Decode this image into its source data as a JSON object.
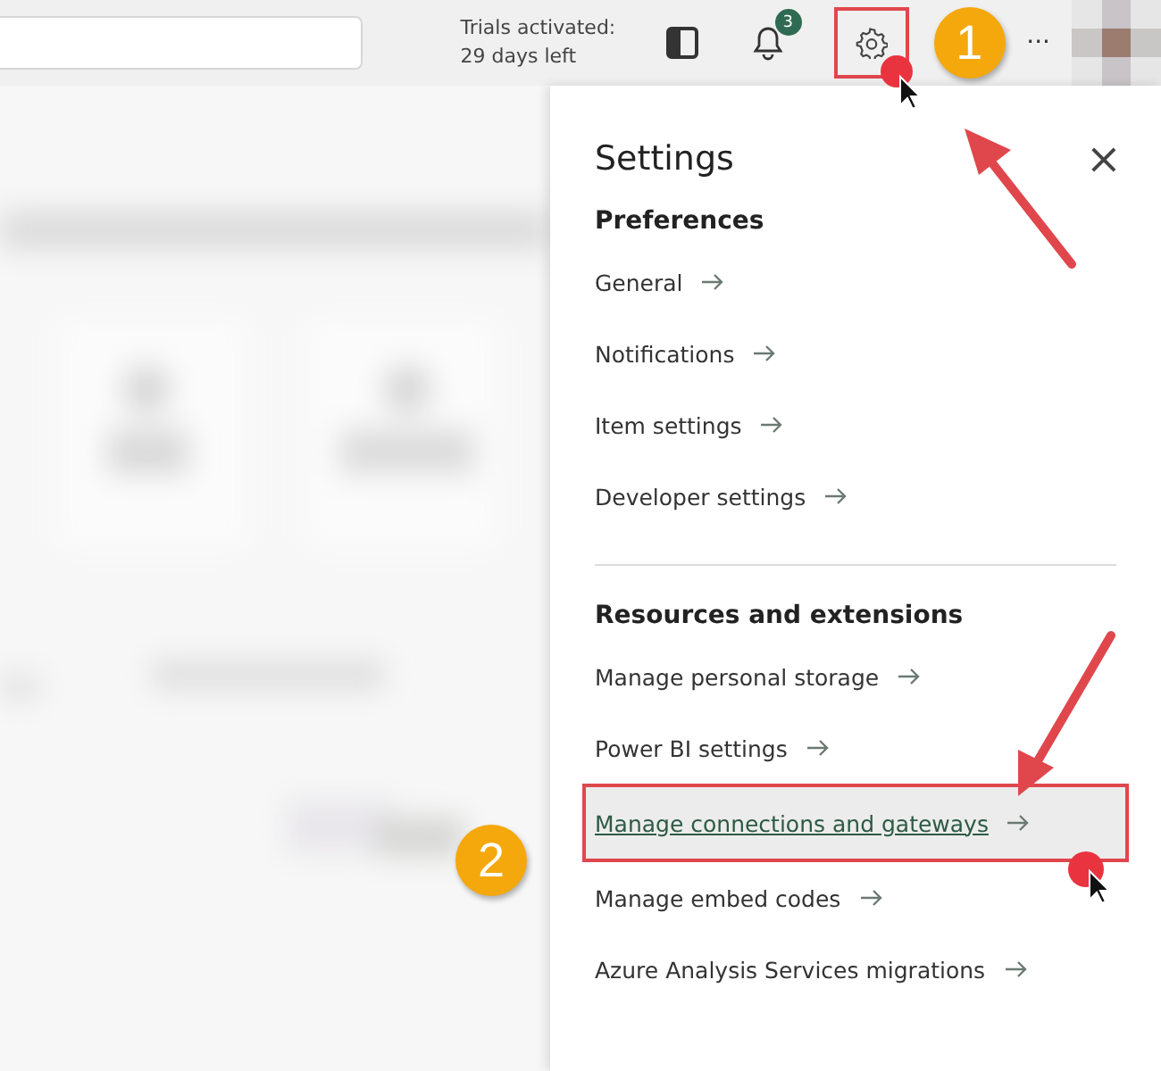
{
  "topbar": {
    "trial_lines": [
      "Trials activated:",
      "29 days left"
    ],
    "notification_count": "3",
    "more": "···"
  },
  "settings_panel": {
    "title": "Settings",
    "close": "×",
    "sections": [
      {
        "heading": "Preferences",
        "items": [
          {
            "label": "General",
            "selected": false
          },
          {
            "label": "Notifications",
            "selected": false
          },
          {
            "label": "Item settings",
            "selected": false
          },
          {
            "label": "Developer settings",
            "selected": false
          }
        ]
      },
      {
        "heading": "Resources and extensions",
        "items": [
          {
            "label": "Manage personal storage",
            "selected": false
          },
          {
            "label": "Power BI settings",
            "selected": false
          },
          {
            "label": "Manage connections and gateways",
            "selected": true
          },
          {
            "label": "Manage embed codes",
            "selected": false
          },
          {
            "label": "Azure Analysis Services migrations",
            "selected": false
          }
        ]
      }
    ]
  },
  "callouts": [
    "1",
    "2"
  ]
}
